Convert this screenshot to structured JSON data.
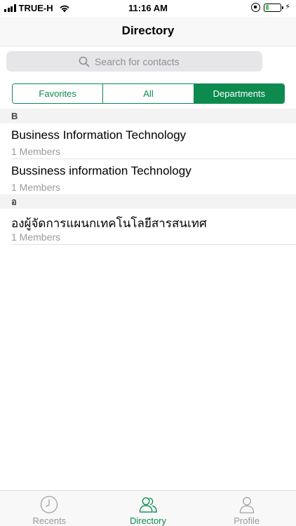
{
  "status_bar": {
    "carrier": "TRUE-H",
    "time": "11:16 AM",
    "battery_level": 0.2,
    "battery_color": "#5ac95a"
  },
  "nav": {
    "title": "Directory"
  },
  "search": {
    "placeholder": "Search for contacts",
    "icon": "search-icon"
  },
  "segments": {
    "favorites": "Favorites",
    "all": "All",
    "departments": "Departments",
    "selected": "departments"
  },
  "accent_color": "#0d8a4e",
  "sections": [
    {
      "header": "B",
      "items": [
        {
          "title": "Business Information Technology",
          "subtitle": "1 Members"
        },
        {
          "title": "Bussiness information Technology",
          "subtitle": "1 Members"
        }
      ]
    },
    {
      "header": "อ",
      "items": [
        {
          "title": "องผู้จัดการแผนกเทคโนโลยีสารสนเทศ",
          "subtitle": "1 Members"
        }
      ]
    }
  ],
  "tab_bar": {
    "recents": {
      "label": "Recents",
      "icon": "clock-icon"
    },
    "directory": {
      "label": "Directory",
      "icon": "people-icon"
    },
    "profile": {
      "label": "Profile",
      "icon": "person-icon"
    },
    "selected": "directory"
  }
}
